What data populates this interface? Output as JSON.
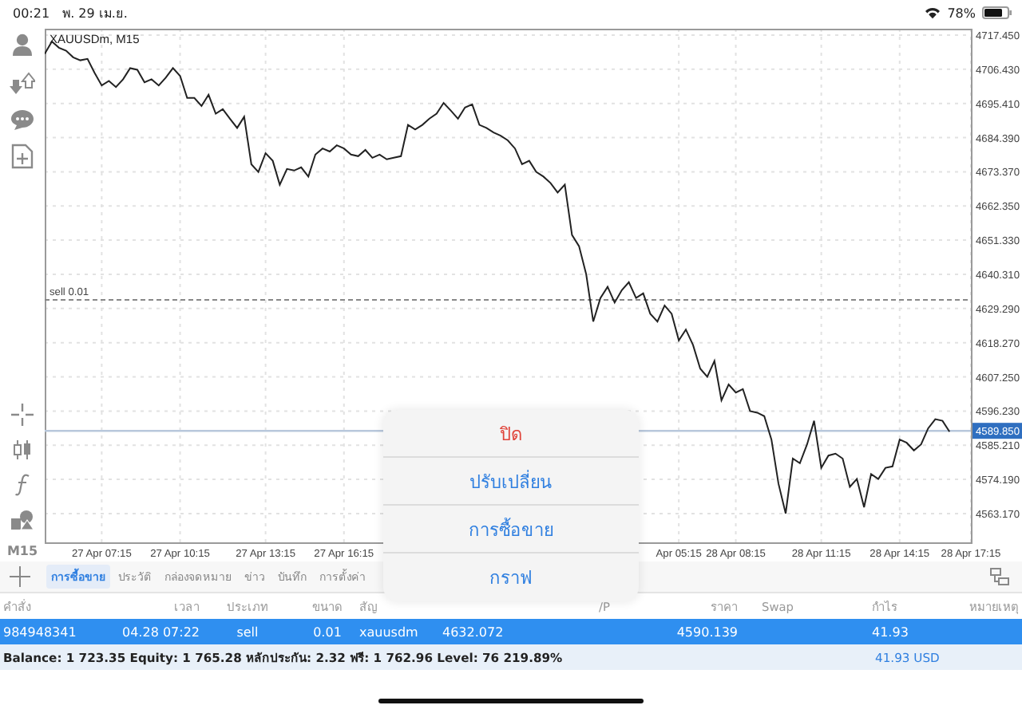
{
  "status_bar": {
    "time": "00:21",
    "date": "พ. 29 เม.ย.",
    "battery": "78%"
  },
  "toolbar": {
    "period": "M15"
  },
  "chart": {
    "chart_data": {
      "type": "line",
      "title": "XAUUSDm, M15",
      "grid": true,
      "ylim": [
        4553.9,
        4719.5
      ],
      "categories": [
        null,
        null,
        null,
        null,
        null,
        null,
        null,
        null,
        "27 Apr 07:15",
        null,
        null,
        null,
        null,
        null,
        null,
        null,
        null,
        null,
        null,
        "27 Apr 10:15",
        null,
        null,
        null,
        null,
        null,
        null,
        null,
        null,
        null,
        null,
        null,
        "27 Apr 13:15",
        null,
        null,
        null,
        null,
        null,
        null,
        null,
        null,
        null,
        null,
        "27 Apr 16:15",
        null,
        null,
        null,
        null,
        null,
        null,
        null,
        null,
        null,
        null,
        null,
        null,
        null,
        null,
        null,
        null,
        null,
        null,
        null,
        null,
        null,
        null,
        null,
        null,
        null,
        null,
        null,
        null,
        null,
        null,
        null,
        null,
        null,
        null,
        null,
        null,
        null,
        null,
        null,
        null,
        null,
        null,
        null,
        null,
        null,
        null,
        "Apr 05:15",
        null,
        null,
        null,
        null,
        null,
        null,
        null,
        "28 Apr 08:15",
        null,
        null,
        null,
        null,
        null,
        null,
        null,
        null,
        null,
        null,
        null,
        "28 Apr 11:15",
        null,
        null,
        null,
        null,
        null,
        null,
        null,
        null,
        null,
        null,
        "28 Apr 14:15",
        null,
        null,
        null,
        null,
        null,
        null,
        null,
        null,
        null,
        "28 Apr 17:15"
      ],
      "yticks": [
        {
          "value": 4717.45,
          "label": "4717.450"
        },
        {
          "value": 4706.43,
          "label": "4706.430"
        },
        {
          "value": 4695.41,
          "label": "4695.410"
        },
        {
          "value": 4684.39,
          "label": "4684.390"
        },
        {
          "value": 4673.37,
          "label": "4673.370"
        },
        {
          "value": 4662.35,
          "label": "4662.350"
        },
        {
          "value": 4651.33,
          "label": "4651.330"
        },
        {
          "value": 4640.31,
          "label": "4640.310"
        },
        {
          "value": 4629.29,
          "label": "4629.290"
        },
        {
          "value": 4618.27,
          "label": "4618.270"
        },
        {
          "value": 4607.25,
          "label": "4607.250"
        },
        {
          "value": 4596.23,
          "label": "4596.230"
        },
        {
          "value": 4585.21,
          "label": "4585.210"
        },
        {
          "value": 4574.19,
          "label": "4574.190"
        },
        {
          "value": 4563.17,
          "label": "4563.170"
        }
      ],
      "series": [
        {
          "color": "#222222",
          "values": [
            4711.4,
            4715.4,
            4713.4,
            4712.4,
            4710.3,
            4709.3,
            4709.8,
            4705.3,
            4701.2,
            4702.7,
            4700.7,
            4703.2,
            4706.8,
            4706.3,
            4702.2,
            4703.2,
            4701.2,
            4703.7,
            4706.8,
            4704.3,
            4697.2,
            4697.2,
            4694.6,
            4698.2,
            4692.1,
            4693.6,
            4690.5,
            4687.5,
            4691.1,
            4675.8,
            4673.3,
            4679.4,
            4676.9,
            4669.2,
            4674.3,
            4673.8,
            4674.8,
            4671.8,
            4678.9,
            4680.9,
            4679.9,
            4681.9,
            4680.9,
            4678.9,
            4678.4,
            4680.4,
            4677.9,
            4678.9,
            4677.4,
            4677.9,
            4678.4,
            4688.5,
            4687.0,
            4688.5,
            4690.5,
            4692.1,
            4695.6,
            4693.1,
            4690.5,
            4694.1,
            4695.1,
            4688.5,
            4687.5,
            4686.0,
            4685.0,
            4683.5,
            4680.9,
            4675.8,
            4676.9,
            4673.3,
            4671.8,
            4669.7,
            4666.7,
            4669.2,
            4653.0,
            4649.4,
            4640.3,
            4625.1,
            4632.7,
            4636.3,
            4631.2,
            4635.2,
            4637.8,
            4632.7,
            4634.2,
            4627.6,
            4625.1,
            4630.2,
            4627.6,
            4619.0,
            4622.5,
            4617.5,
            4609.9,
            4607.3,
            4612.4,
            4599.7,
            4604.8,
            4602.2,
            4603.3,
            4596.2,
            4595.7,
            4594.6,
            4587.0,
            4572.8,
            4563.2,
            4580.9,
            4579.4,
            4585.5,
            4593.1,
            4577.9,
            4581.9,
            4582.5,
            4580.9,
            4571.8,
            4574.3,
            4565.2,
            4575.9,
            4574.3,
            4577.9,
            4578.4,
            4587.0,
            4586.0,
            4583.5,
            4585.5,
            4590.6,
            4593.6,
            4593.1,
            4589.6,
            null,
            null,
            null
          ]
        }
      ],
      "ref_lines": [
        {
          "axis": "y",
          "value": 4632.072,
          "label": "sell 0.01",
          "color": "#888888"
        },
        {
          "axis": "y",
          "value": 4589.85,
          "color": "#b8c8dc"
        }
      ],
      "annotations": [
        {
          "y": 4589.85,
          "text": "4589.850"
        }
      ]
    }
  },
  "tabs": [
    {
      "label": "การซื้อขาย",
      "selected": true
    },
    {
      "label": "ประวัติ",
      "selected": false
    },
    {
      "label": "กล่องจดหมาย",
      "selected": false
    },
    {
      "label": "ข่าว",
      "selected": false
    },
    {
      "label": "บันทึก",
      "selected": false
    },
    {
      "label": "การตั้งค่า",
      "selected": false
    }
  ],
  "table": {
    "columns": [
      "คำสั่ง",
      "เวลา",
      "ประเภท",
      "ขนาด",
      "สัญ",
      null,
      null,
      "/P",
      "ราคา",
      "Swap",
      "กำไร",
      "หมายเหตุ"
    ],
    "rows": [
      {
        "selected": true,
        "cells": [
          "984948341",
          "04.28 07:22",
          "sell",
          "0.01",
          "xauusdm",
          "4632.072",
          null,
          null,
          "4590.139",
          null,
          "41.93",
          null
        ]
      }
    ],
    "summary": {
      "text": "Balance: 1 723.35 Equity: 1 765.28 หลักประกัน: 2.32 ฟรี: 1 762.96 Level: 76 219.89%",
      "profit": "41.93  USD"
    }
  },
  "popup_menu": {
    "items": [
      {
        "label": "ปิด",
        "kind": "destructive"
      },
      {
        "label": "ปรับเปลี่ยน",
        "kind": "default"
      },
      {
        "label": "การซื้อขาย",
        "kind": "default"
      },
      {
        "label": "กราฟ",
        "kind": "default"
      }
    ]
  }
}
